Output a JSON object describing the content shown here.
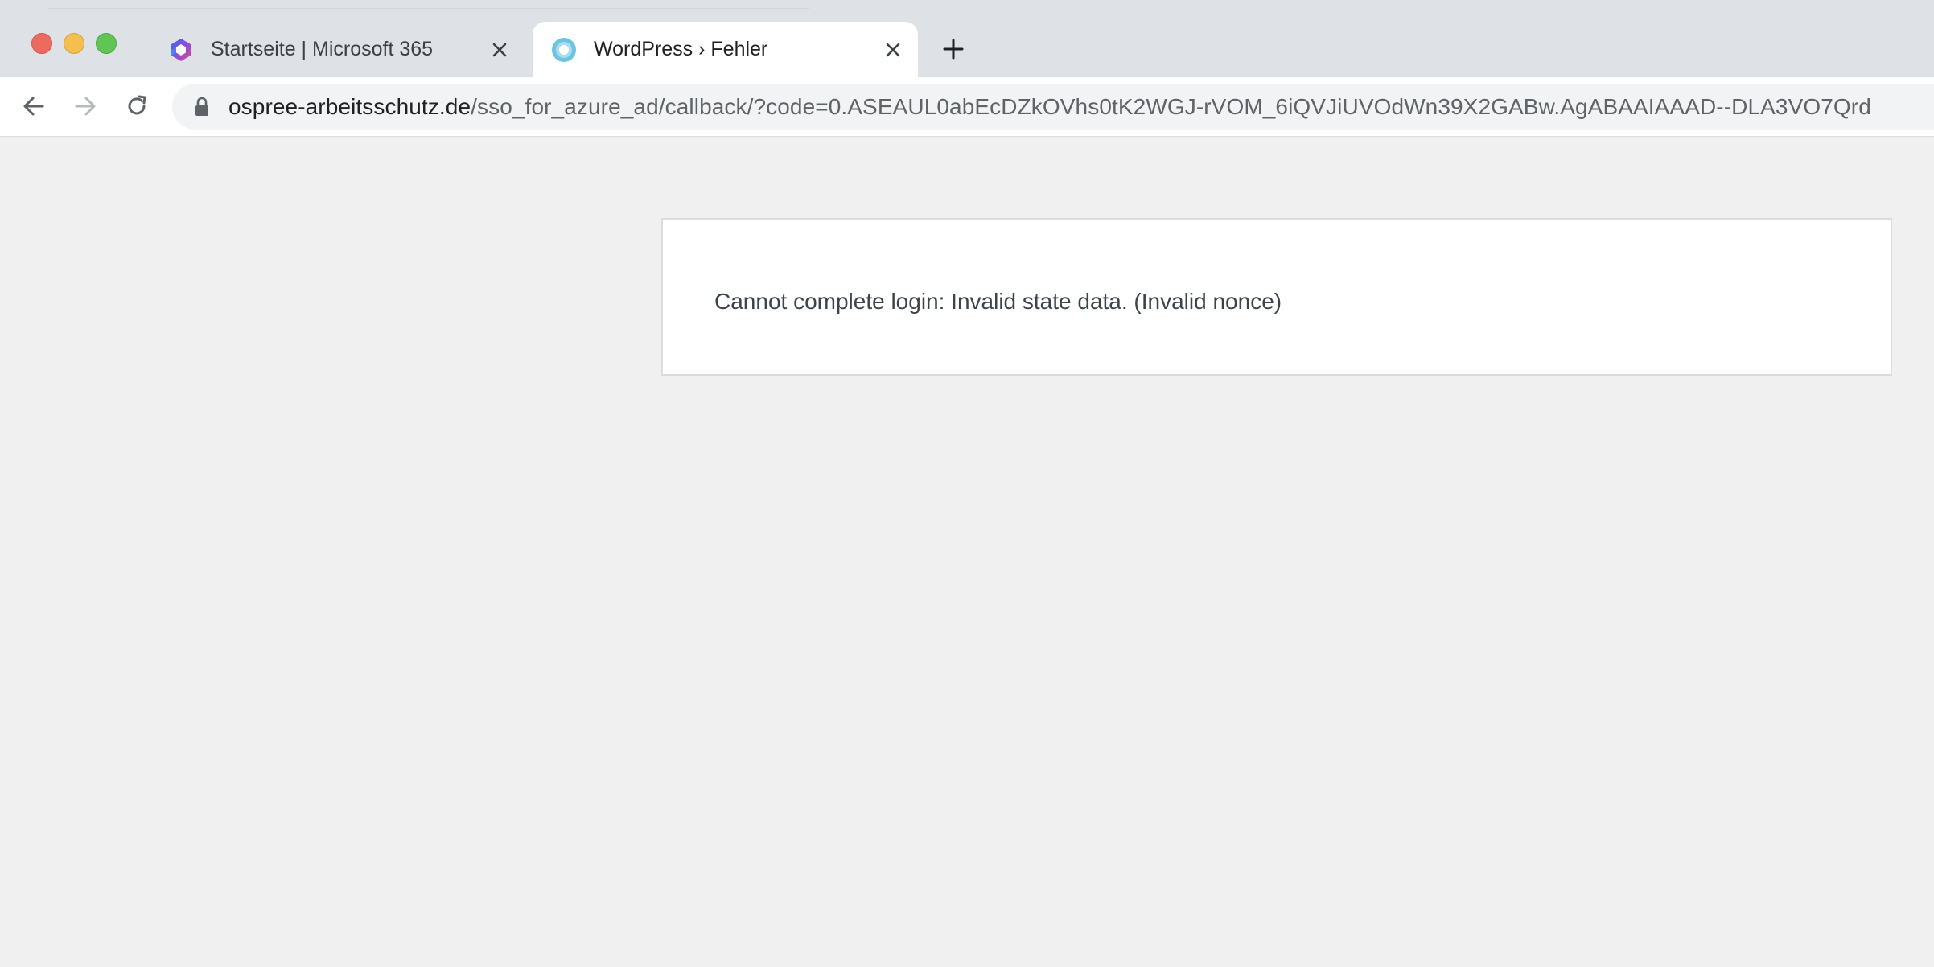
{
  "browser": {
    "tabs": [
      {
        "title": "Startseite | Microsoft 365",
        "icon": "microsoft-365-icon",
        "active": false
      },
      {
        "title": "WordPress › Fehler",
        "icon": "wordpress-icon",
        "active": true
      }
    ],
    "new_tab_icon": "plus-icon",
    "close_icon": "close-icon"
  },
  "toolbar": {
    "back_icon": "arrow-left-icon",
    "forward_icon": "arrow-right-icon",
    "reload_icon": "reload-icon",
    "lock_icon": "lock-icon",
    "url_host": "ospree-arbeitsschutz.de",
    "url_path": "/sso_for_azure_ad/callback/?code=0.ASEAUL0abEcDZkOVhs0tK2WGJ-rVOM_6iQVJiUVOdWn39X2GABw.AgABAAIAAAD--DLA3VO7Qrd"
  },
  "page": {
    "error_message": "Cannot complete login: Invalid state data. (Invalid nonce)"
  },
  "colors": {
    "tabstrip": "#dee1e6",
    "page_background": "#f0f0f1",
    "box_border": "#dcdcde",
    "text": "#3c434a"
  }
}
